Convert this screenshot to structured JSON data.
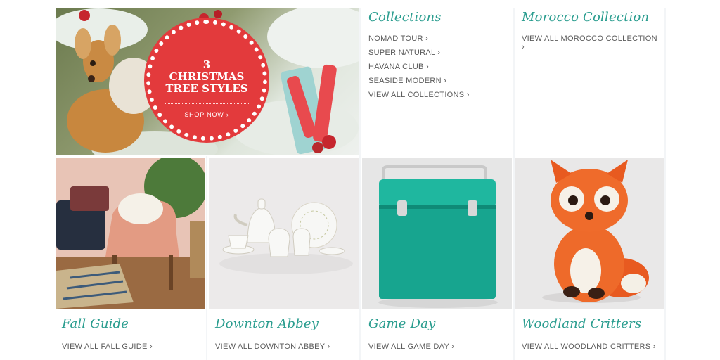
{
  "hero": {
    "badge_title": "3 CHRISTMAS TREE STYLES",
    "badge_cta": "SHOP NOW ›"
  },
  "collections": {
    "heading": "Collections",
    "items": [
      "NOMAD TOUR ›",
      "SUPER NATURAL ›",
      "HAVANA CLUB ›",
      "SEASIDE MODERN ›",
      "VIEW ALL COLLECTIONS ›"
    ]
  },
  "morocco": {
    "heading": "Morocco Collection",
    "link": "VIEW ALL MOROCCO COLLECTION ›"
  },
  "tiles": [
    {
      "title": "Fall Guide",
      "link": "VIEW ALL FALL GUIDE ›"
    },
    {
      "title": "Downton Abbey",
      "link": "VIEW ALL DOWNTON ABBEY ›"
    },
    {
      "title": "Game Day",
      "link": "VIEW ALL GAME DAY ›"
    },
    {
      "title": "Woodland Critters",
      "link": "VIEW ALL WOODLAND CRITTERS ›"
    }
  ],
  "colors": {
    "accent_teal": "#2a9d8f",
    "badge_red": "#e33a3c",
    "link_gray": "#5a5a5a"
  }
}
